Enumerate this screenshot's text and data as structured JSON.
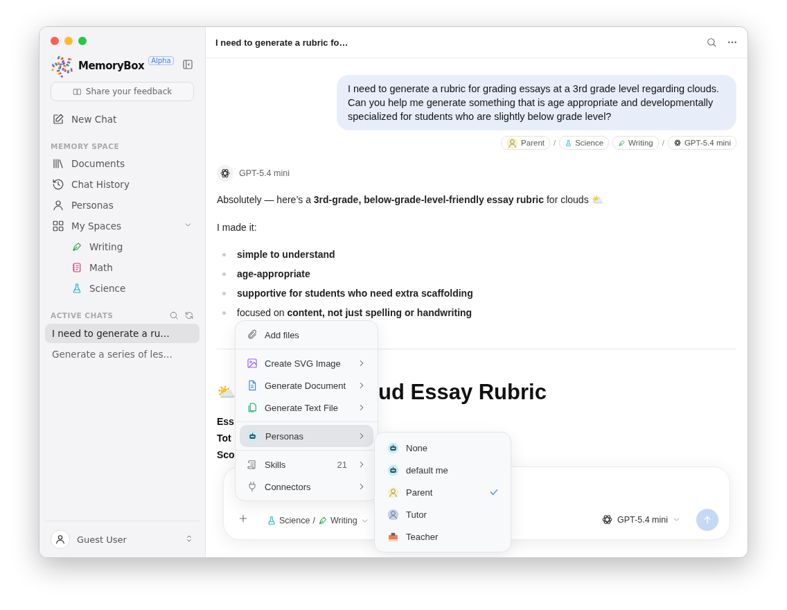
{
  "sidebar": {
    "brand": "MemoryBox",
    "badge": "Alpha",
    "feedback": "Share your feedback",
    "new_chat": "New Chat",
    "memory_section": "MEMORY SPACE",
    "nav": [
      {
        "label": "Documents"
      },
      {
        "label": "Chat History"
      },
      {
        "label": "Personas"
      },
      {
        "label": "My Spaces",
        "expanded": true,
        "children": [
          {
            "label": "Writing"
          },
          {
            "label": "Math"
          },
          {
            "label": "Science"
          }
        ]
      }
    ],
    "chats_section": "ACTIVE CHATS",
    "chats": [
      {
        "label": "I need to generate a ru…",
        "selected": true
      },
      {
        "label": "Generate a series of les…",
        "selected": false
      }
    ],
    "user": "Guest User"
  },
  "header": {
    "title": "I need to generate a rubric fo…"
  },
  "user_message": {
    "text": "I need to generate a rubric for grading essays at a 3rd grade level regarding clouds. Can you help me generate something that is age appropriate and developmentally specialized for students who are slightly below grade level?",
    "tags": [
      {
        "kind": "chip",
        "label": "Parent"
      },
      {
        "kind": "separator",
        "label": "/"
      },
      {
        "kind": "chip",
        "label": "Science"
      },
      {
        "kind": "chip",
        "label": "Writing"
      },
      {
        "kind": "separator",
        "label": "/"
      },
      {
        "kind": "chip",
        "label": "GPT-5.4 mini"
      }
    ]
  },
  "assistant": {
    "model": "GPT-5.4 mini",
    "intro": "Absolutely — here’s a **3rd-grade, below-grade-level-friendly essay rubric** for clouds ⛅",
    "lead": "I made it:",
    "bullets": [
      {
        "text": "simple to understand",
        "bold": true
      },
      {
        "text": "age-appropriate",
        "bold": true
      },
      {
        "text": "supportive for students who need extra scaffolding",
        "bold": true
      },
      {
        "text": "focused on **content, not just spelling or handwriting**",
        "bold": false
      }
    ],
    "heading_emoji": "⛅",
    "heading": "ud Essay Rubric",
    "lines": [
      "Ess",
      "Tot",
      "Sco"
    ]
  },
  "composer": {
    "spaces": [
      {
        "label": "Science"
      },
      {
        "label": "Writing"
      }
    ],
    "space_separator": "/",
    "model": "GPT-5.4 mini"
  },
  "attach_menu": {
    "groups": [
      [
        {
          "label": "Add files",
          "submenu": false,
          "selected": false
        }
      ],
      [
        {
          "label": "Create SVG Image",
          "submenu": true,
          "selected": false
        },
        {
          "label": "Generate Document",
          "submenu": true,
          "selected": false
        },
        {
          "label": "Generate Text File",
          "submenu": true,
          "selected": false
        }
      ],
      [
        {
          "label": "Personas",
          "submenu": true,
          "selected": true
        }
      ],
      [
        {
          "label": "Skills",
          "count": "21",
          "submenu": true,
          "selected": false
        },
        {
          "label": "Connectors",
          "submenu": true,
          "selected": false
        }
      ]
    ]
  },
  "persona_menu": {
    "items": [
      {
        "label": "None",
        "selected": false
      },
      {
        "label": "default me",
        "selected": false
      },
      {
        "label": "Parent",
        "selected": true
      },
      {
        "label": "Tutor",
        "selected": false
      },
      {
        "label": "Teacher",
        "selected": false
      }
    ]
  }
}
